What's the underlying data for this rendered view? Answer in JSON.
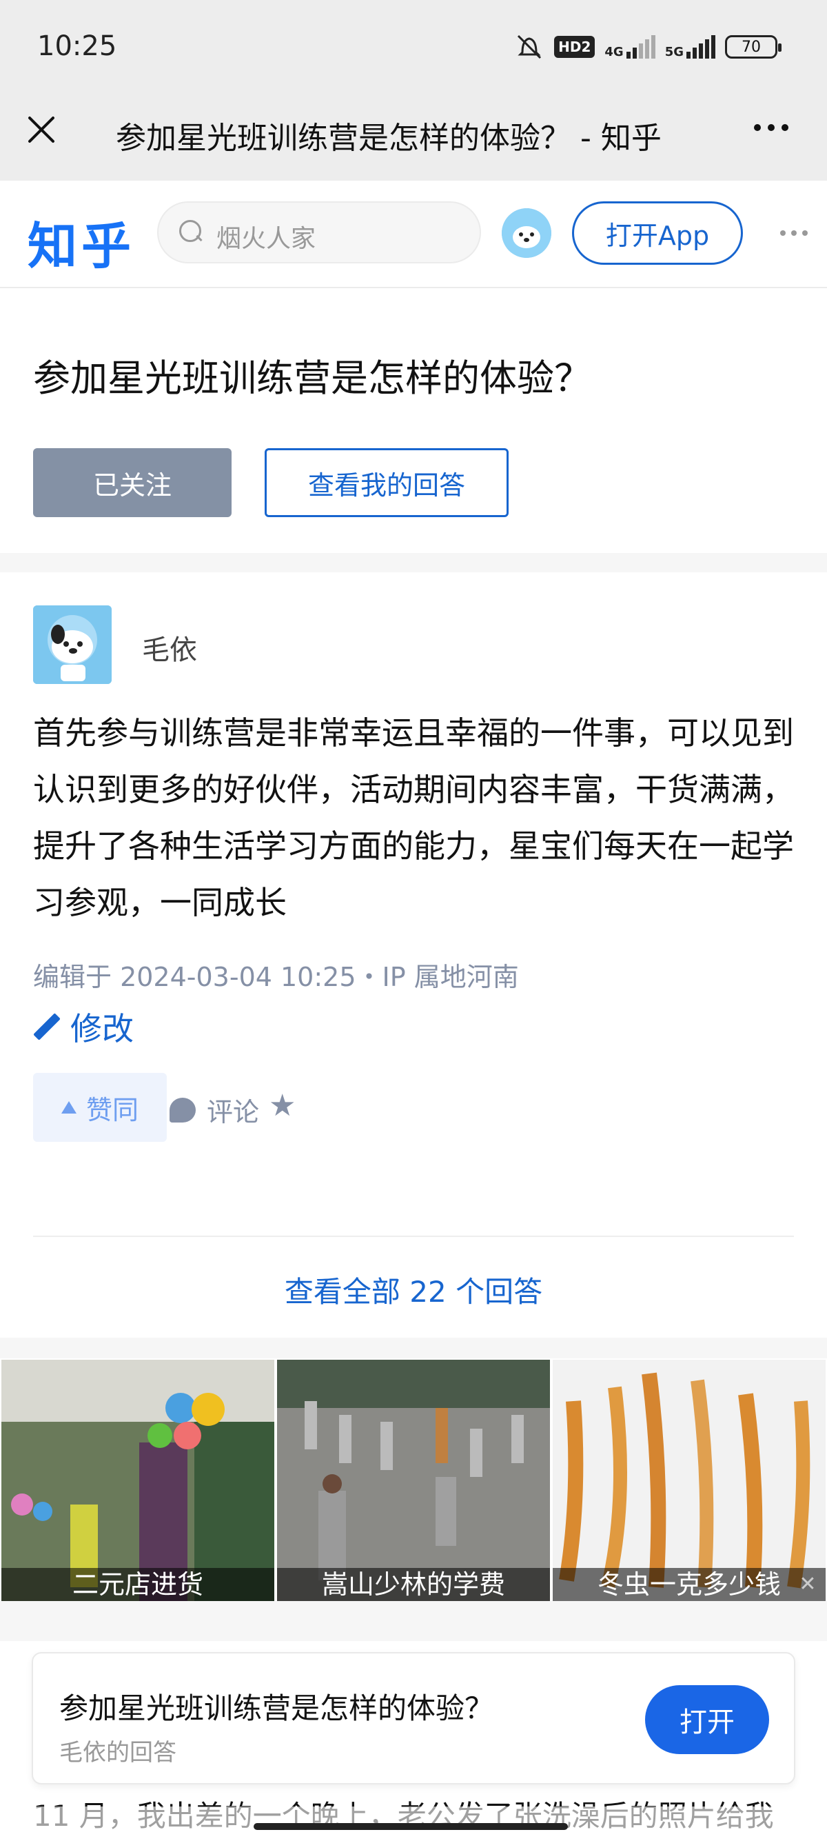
{
  "status_bar": {
    "time": "10:25",
    "hd_badge": "HD2",
    "net1": "4G",
    "net2": "5G",
    "battery": "70"
  },
  "title_bar": {
    "title": "参加星光班训练营是怎样的体验？ - 知乎"
  },
  "header": {
    "logo": "知乎",
    "search_placeholder": "烟火人家",
    "open_app": "打开App",
    "brand_color": "#1772f6"
  },
  "question": {
    "title": "参加星光班训练营是怎样的体验？",
    "followed_label": "已关注",
    "view_answer_label": "查看我的回答"
  },
  "answer": {
    "author": "毛依",
    "body": "首先参与训练营是非常幸运且幸福的一件事，可以见到认识到更多的好伙伴，活动期间内容丰富，干货满满，提升了各种生活学习方面的能力，星宝们每天在一起学习参观，一同成长",
    "meta": "编辑于 2024-03-04 10:25・IP 属地河南",
    "edit_label": "修改",
    "vote_label": "赞同",
    "comment_label": "评论",
    "view_all": "查看全部 22 个回答"
  },
  "ads": [
    {
      "caption": "二元店进货",
      "icon": "store-image"
    },
    {
      "caption": "嵩山少林的学费",
      "icon": "kungfu-image"
    },
    {
      "caption": "冬虫一克多少钱",
      "icon": "cordyceps-image"
    }
  ],
  "open_card": {
    "title": "参加星光班训练营是怎样的体验？",
    "subtitle": "毛依的回答",
    "button": "打开"
  },
  "bottom_peek": "11 月，我出差的一个晚上，老公发了张洗澡后的照片给我"
}
